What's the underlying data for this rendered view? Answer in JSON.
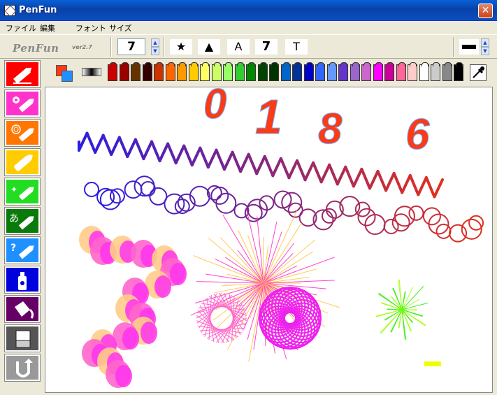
{
  "window": {
    "title": "PenFun",
    "close_glyph": "✕"
  },
  "menu": {
    "items": [
      "ファイル",
      "編集",
      "フォント",
      "サイズ"
    ]
  },
  "toolbar": {
    "logo": "PenFun",
    "version": "ver2.7",
    "brush_size": "7",
    "shape_buttons": [
      "★",
      "▲",
      "A",
      "7",
      "T"
    ],
    "spinner_up": "▲",
    "spinner_down": "▼"
  },
  "tools": [
    {
      "name": "pencil-tool",
      "color": "#ff0000",
      "icon": "pencil-icon"
    },
    {
      "name": "flower-stamp-tool",
      "color": "#ff33cc",
      "icon": "flower-pencil-icon"
    },
    {
      "name": "spiral-pen-tool",
      "color": "#ff7700",
      "icon": "spiral-pencil-icon"
    },
    {
      "name": "marker-tool",
      "color": "#ffcc00",
      "icon": "marker-icon"
    },
    {
      "name": "sparkle-pen-tool",
      "color": "#22dd22",
      "icon": "sparkle-pencil-icon"
    },
    {
      "name": "text-pen-tool",
      "color": "#0a7a0a",
      "icon": "text-pencil-icon"
    },
    {
      "name": "random-pen-tool",
      "color": "#1e90ff",
      "icon": "question-pencil-icon"
    },
    {
      "name": "spray-tool",
      "color": "#0000dd",
      "icon": "spray-can-icon"
    },
    {
      "name": "fill-tool",
      "color": "#660066",
      "icon": "paint-bucket-icon"
    },
    {
      "name": "eraser-tool",
      "color": "#555555",
      "icon": "eraser-icon"
    },
    {
      "name": "undo-tool",
      "color": "#999999",
      "icon": "undo-icon"
    }
  ],
  "tool_text": {
    "text_pen": "あ",
    "random_pen": "?"
  },
  "palette": {
    "foreground": "#ff3a13",
    "background": "#1e90ff",
    "colors": [
      "#cc0000",
      "#990000",
      "#663300",
      "#330000",
      "#cc3300",
      "#ff6600",
      "#ff9900",
      "#ffcc00",
      "#ffff66",
      "#ccff66",
      "#99ff66",
      "#33cc33",
      "#008800",
      "#004400",
      "#003300",
      "#0066cc",
      "#003399",
      "#0000cc",
      "#3366ff",
      "#6699ff",
      "#6633cc",
      "#9966cc",
      "#cc66cc",
      "#ff00ff",
      "#cc0099",
      "#ff6699",
      "#ffcccc",
      "#ffffff",
      "#cccccc",
      "#888888",
      "#000000"
    ]
  },
  "canvas": {
    "stamped_digits": [
      {
        "text": "0",
        "color": "#ff3a13"
      },
      {
        "text": "1",
        "color": "#ff3a13"
      },
      {
        "text": "8",
        "color": "#ff3a13"
      },
      {
        "text": "6",
        "color": "#ff3a13"
      }
    ]
  }
}
